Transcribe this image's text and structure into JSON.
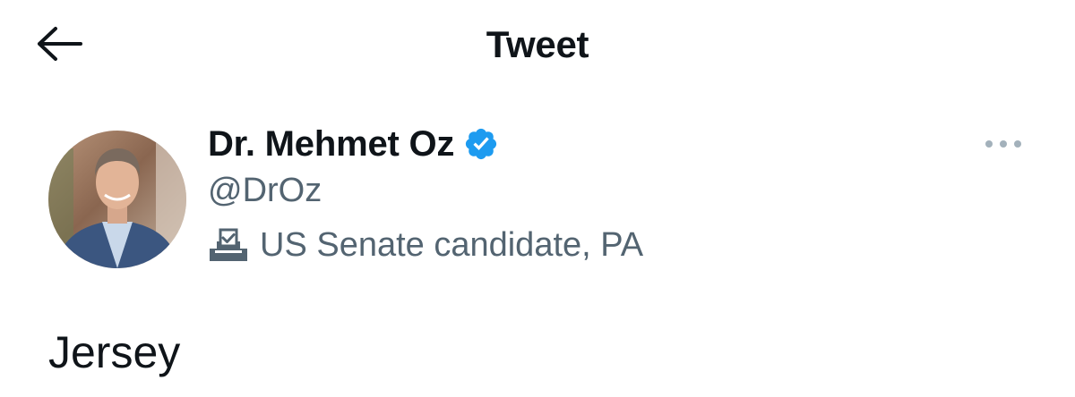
{
  "header": {
    "title": "Tweet",
    "back_icon": "arrow-left-icon"
  },
  "author": {
    "display_name": "Dr. Mehmet Oz",
    "handle": "@DrOz",
    "verified": true,
    "verified_color": "#1d9bf0",
    "label_icon": "ballot-box-icon",
    "label_text": "US Senate candidate, PA"
  },
  "more_icon": "more-horizontal-icon",
  "tweet": {
    "text": "Jersey"
  },
  "colors": {
    "primary_text": "#0f1419",
    "secondary_text": "#536471",
    "accent": "#1d9bf0",
    "more_dots": "#a3b1bb"
  }
}
